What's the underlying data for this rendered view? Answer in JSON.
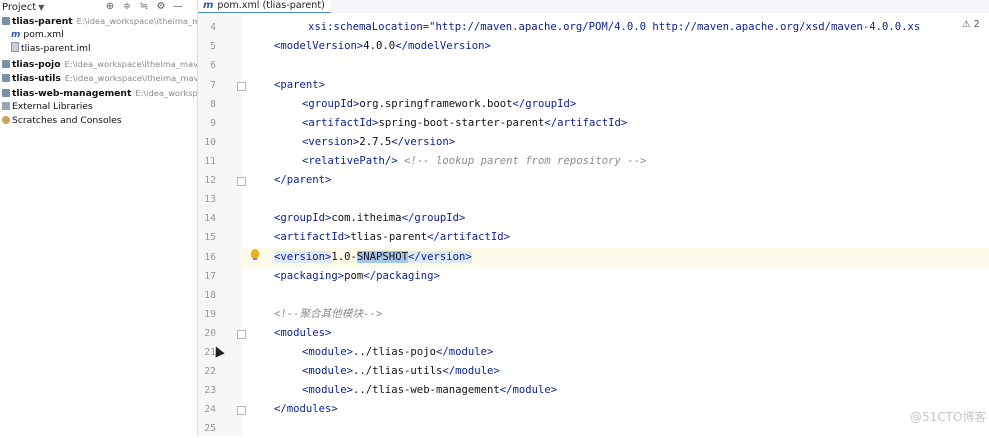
{
  "project_panel": {
    "title": "Project",
    "tree": [
      {
        "label": "tlias-parent",
        "path": "E:\\idea_workspace\\itheima_mave",
        "bold": true,
        "icon": "module-icon"
      },
      {
        "label": "pom.xml",
        "path": "",
        "bold": false,
        "icon": "maven-icon"
      },
      {
        "label": "tlias-parent.iml",
        "path": "",
        "bold": false,
        "icon": "iml-file-icon"
      },
      {
        "label": "tlias-pojo",
        "path": "E:\\idea_workspace\\itheima_maven",
        "bold": true,
        "icon": "module-icon"
      },
      {
        "label": "tlias-utils",
        "path": "E:\\idea_workspace\\itheima_maven_",
        "bold": true,
        "icon": "module-icon"
      },
      {
        "label": "tlias-web-management",
        "path": "E:\\idea_workspace\\",
        "bold": true,
        "icon": "module-icon"
      },
      {
        "label": "External Libraries",
        "path": "",
        "bold": false,
        "icon": "library-icon"
      },
      {
        "label": "Scratches and Consoles",
        "path": "",
        "bold": false,
        "icon": "scratch-icon"
      }
    ]
  },
  "editor": {
    "tab_prefix": "m",
    "tab_label": "pom.xml (tlias-parent)",
    "warning_count": "2",
    "line_numbers": [
      "4",
      "5",
      "6",
      "7",
      "8",
      "9",
      "10",
      "11",
      "12",
      "13",
      "14",
      "15",
      "16",
      "17",
      "18",
      "19",
      "20",
      "21",
      "22",
      "23",
      "24",
      "25"
    ],
    "lines": {
      "l4": "xsi:schemaLocation=\"http://maven.apache.org/POM/4.0.0 http://maven.apache.org/xsd/maven-4.0.0.xs",
      "l5a": "<modelVersion>",
      "l5b": "4.0.0",
      "l5c": "</modelVersion>",
      "l7": "<parent>",
      "l8a": "<groupId>",
      "l8b": "org.springframework.boot",
      "l8c": "</groupId>",
      "l9a": "<artifactId>",
      "l9b": "spring-boot-starter-parent",
      "l9c": "</artifactId>",
      "l10a": "<version>",
      "l10b": "2.7.5",
      "l10c": "</version>",
      "l11a": "<relativePath/>",
      "l11b": " <!-- lookup parent from repository -->",
      "l12": "</parent>",
      "l14a": "<groupId>",
      "l14b": "com.itheima",
      "l14c": "</groupId>",
      "l15a": "<artifactId>",
      "l15b": "tlias-parent",
      "l15c": "</artifactId>",
      "l16a": "<version>",
      "l16b": "1.0-",
      "l16c": "SNAPSHOT",
      "l16d": "</version>",
      "l17a": "<packaging>",
      "l17b": "pom",
      "l17c": "</packaging>",
      "l19": "<!--聚合其他模块-->",
      "l20": "<modules>",
      "l21a": "<module>",
      "l21b": "../tlias-pojo",
      "l21c": "</module>",
      "l22a": "<module>",
      "l22b": "../tlias-utils",
      "l22c": "</module>",
      "l23a": "<module>",
      "l23b": "../tlias-web-management",
      "l23c": "</module>",
      "l24": "</modules>"
    }
  },
  "watermark": "@51CTO博客",
  "colors": {
    "tag": "#0b1f8f",
    "string": "#0a7b2c",
    "comment": "#8c8c8c",
    "selection": "#a7c6ee",
    "tab_underline": "#4a87d9"
  }
}
